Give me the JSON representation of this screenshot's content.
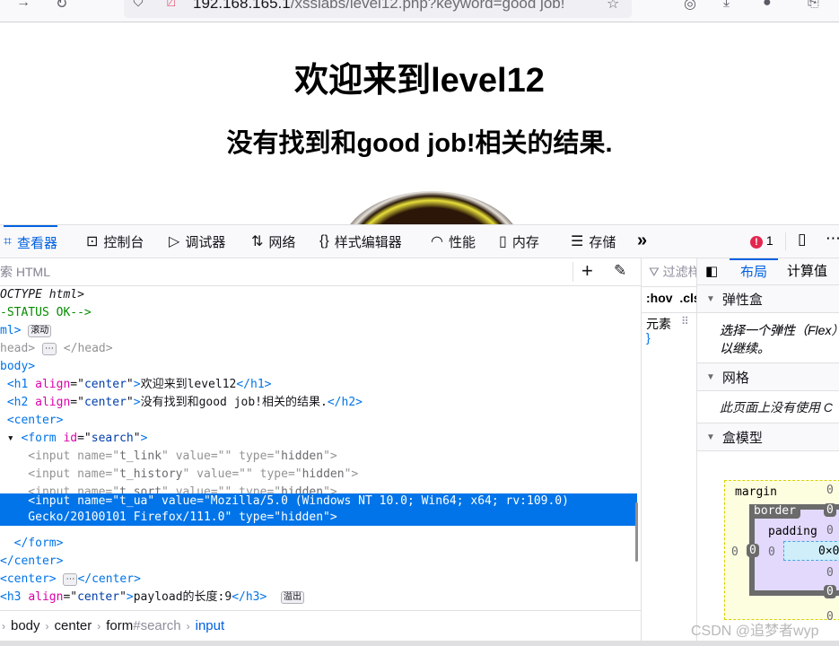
{
  "browser": {
    "url_host": "192.168.165.1",
    "url_path": "/xsslabs/level12.php?keyword=good job!"
  },
  "page": {
    "h1": "欢迎来到level12",
    "h2": "没有找到和good job!相关的结果."
  },
  "devtools": {
    "tabs": [
      {
        "label": "查看器",
        "icon": "inspector-icon",
        "glyph": "⌗",
        "active": true
      },
      {
        "label": "控制台",
        "icon": "console-icon",
        "glyph": "⊡"
      },
      {
        "label": "调试器",
        "icon": "debugger-icon",
        "glyph": "▷"
      },
      {
        "label": "网络",
        "icon": "network-icon",
        "glyph": "⇅"
      },
      {
        "label": "样式编辑器",
        "icon": "style-editor-icon",
        "glyph": "{}"
      },
      {
        "label": "性能",
        "icon": "performance-icon",
        "glyph": "◠"
      },
      {
        "label": "内存",
        "icon": "memory-icon",
        "glyph": "▯"
      },
      {
        "label": "存储",
        "icon": "storage-icon",
        "glyph": "☰"
      }
    ],
    "more": "»",
    "error_count": "1",
    "search_placeholder": "搜索 HTML",
    "search_visible": "索 HTML",
    "markup_lines": [
      {
        "indent": 0,
        "tokens": [
          {
            "c": "dt",
            "v": "OCTYPE html>"
          }
        ]
      },
      {
        "indent": 0,
        "tokens": [
          {
            "c": "cmt",
            "v": "-STATUS OK-->"
          }
        ]
      },
      {
        "indent": 0,
        "tokens": [
          {
            "c": "tag",
            "v": "ml>"
          },
          {
            "c": "badge",
            "v": "滚动"
          }
        ]
      },
      {
        "indent": 0,
        "dim": true,
        "tokens": [
          {
            "c": "tag",
            "v": "head>"
          },
          {
            "c": "badge",
            "v": "⋯"
          },
          {
            "c": "tag",
            "v": " </head>"
          }
        ]
      },
      {
        "indent": 0,
        "tokens": [
          {
            "c": "tag",
            "v": "body>"
          }
        ]
      },
      {
        "indent": 0,
        "tokens": [
          {
            "c": "tag",
            "v": " <h1 "
          },
          {
            "c": "attr",
            "v": "align"
          },
          {
            "c": "txt",
            "v": "=\""
          },
          {
            "c": "val",
            "v": "center"
          },
          {
            "c": "txt",
            "v": "\""
          },
          {
            "c": "tag",
            "v": ">"
          },
          {
            "c": "txt",
            "v": "欢迎来到level12"
          },
          {
            "c": "tag",
            "v": "</h1>"
          }
        ]
      },
      {
        "indent": 0,
        "tokens": [
          {
            "c": "tag",
            "v": " <h2 "
          },
          {
            "c": "attr",
            "v": "align"
          },
          {
            "c": "txt",
            "v": "=\""
          },
          {
            "c": "val",
            "v": "center"
          },
          {
            "c": "txt",
            "v": "\""
          },
          {
            "c": "tag",
            "v": ">"
          },
          {
            "c": "txt",
            "v": "没有找到和good job!相关的结果."
          },
          {
            "c": "tag",
            "v": "</h2>"
          }
        ]
      },
      {
        "indent": 0,
        "tokens": [
          {
            "c": "tag",
            "v": " <center>"
          }
        ]
      },
      {
        "indent": 0,
        "tokens": [
          {
            "c": "txt",
            "v": " ▾ "
          },
          {
            "c": "tag",
            "v": "<form "
          },
          {
            "c": "attr",
            "v": "id"
          },
          {
            "c": "txt",
            "v": "=\""
          },
          {
            "c": "val",
            "v": "search"
          },
          {
            "c": "txt",
            "v": "\""
          },
          {
            "c": "tag",
            "v": ">"
          }
        ]
      },
      {
        "indent": 0,
        "dim": true,
        "tokens": [
          {
            "c": "tag",
            "v": "    <input "
          },
          {
            "c": "attr",
            "v": "name"
          },
          {
            "c": "tag",
            "v": "=\""
          },
          {
            "c": "hidv",
            "v": "t_link"
          },
          {
            "c": "tag",
            "v": "\" "
          },
          {
            "c": "attr",
            "v": "value"
          },
          {
            "c": "tag",
            "v": "=\"\" "
          },
          {
            "c": "attr",
            "v": "type"
          },
          {
            "c": "tag",
            "v": "=\""
          },
          {
            "c": "hidv",
            "v": "hidden"
          },
          {
            "c": "tag",
            "v": "\">"
          }
        ]
      },
      {
        "indent": 0,
        "dim": true,
        "tokens": [
          {
            "c": "tag",
            "v": "    <input "
          },
          {
            "c": "attr",
            "v": "name"
          },
          {
            "c": "tag",
            "v": "=\""
          },
          {
            "c": "hidv",
            "v": "t_history"
          },
          {
            "c": "tag",
            "v": "\" "
          },
          {
            "c": "attr",
            "v": "value"
          },
          {
            "c": "tag",
            "v": "=\"\" "
          },
          {
            "c": "attr",
            "v": "type"
          },
          {
            "c": "tag",
            "v": "=\""
          },
          {
            "c": "hidv",
            "v": "hidden"
          },
          {
            "c": "tag",
            "v": "\">"
          }
        ]
      },
      {
        "indent": 0,
        "dim": true,
        "tokens": [
          {
            "c": "tag",
            "v": "    <input "
          },
          {
            "c": "attr",
            "v": "name"
          },
          {
            "c": "tag",
            "v": "=\""
          },
          {
            "c": "hidv",
            "v": "t_sort"
          },
          {
            "c": "tag",
            "v": "\" "
          },
          {
            "c": "attr",
            "v": "value"
          },
          {
            "c": "tag",
            "v": "=\"\" "
          },
          {
            "c": "attr",
            "v": "type"
          },
          {
            "c": "tag",
            "v": "=\""
          },
          {
            "c": "hidv",
            "v": "hidden"
          },
          {
            "c": "tag",
            "v": "\">"
          }
        ]
      },
      {
        "indent": 0,
        "selected": true,
        "tokens": [
          {
            "c": "txt",
            "v": "    <input name=\"t_ua\" value=\"Mozilla/5.0 (Windows NT 10.0; Win64; x64; rv:109.0)\n    Gecko/20100101 Firefox/111.0\" type=\"hidden\">"
          }
        ]
      },
      {
        "indent": 0,
        "tokens": [
          {
            "c": "tag",
            "v": "  </form>"
          }
        ]
      },
      {
        "indent": 0,
        "tokens": [
          {
            "c": "tag",
            "v": "</center>"
          }
        ]
      },
      {
        "indent": 0,
        "tokens": [
          {
            "c": "tag",
            "v": "<center>"
          },
          {
            "c": "badge",
            "v": "⋯"
          },
          {
            "c": "tag",
            "v": "</center>"
          }
        ]
      },
      {
        "indent": 0,
        "tokens": [
          {
            "c": "tag",
            "v": "<h3 "
          },
          {
            "c": "attr",
            "v": "align"
          },
          {
            "c": "txt",
            "v": "=\""
          },
          {
            "c": "val",
            "v": "center"
          },
          {
            "c": "txt",
            "v": "\""
          },
          {
            "c": "tag",
            "v": ">"
          },
          {
            "c": "txt",
            "v": "payload的长度:9"
          },
          {
            "c": "tag",
            "v": "</h3> "
          },
          {
            "c": "badge",
            "v": "溢出"
          }
        ]
      }
    ],
    "breadcrumbs": [
      "body",
      "center",
      "form#search",
      "input"
    ],
    "rules": {
      "filter": "过滤样式",
      "hov": ":hov",
      "cls": ".cls",
      "element": "元素",
      "brace": "}"
    },
    "layout": {
      "tabs": [
        "布局",
        "计算值"
      ],
      "sections": [
        {
          "title": "弹性盒",
          "body": "选择一个弹性（Flex）容器或项目以继续。",
          "body_visible": [
            "选择一个弹性（Flex",
            "以继续。"
          ]
        },
        {
          "title": "网格",
          "body_visible": [
            "此页面上没有使用 C"
          ]
        },
        {
          "title": "盒模型"
        }
      ],
      "box": {
        "margin_label": "margin",
        "border_label": "border",
        "padding_label": "padding",
        "margin": "0",
        "border": "0",
        "padding": "0",
        "content": "0×0"
      }
    }
  },
  "watermark": "CSDN @追梦者wyp"
}
